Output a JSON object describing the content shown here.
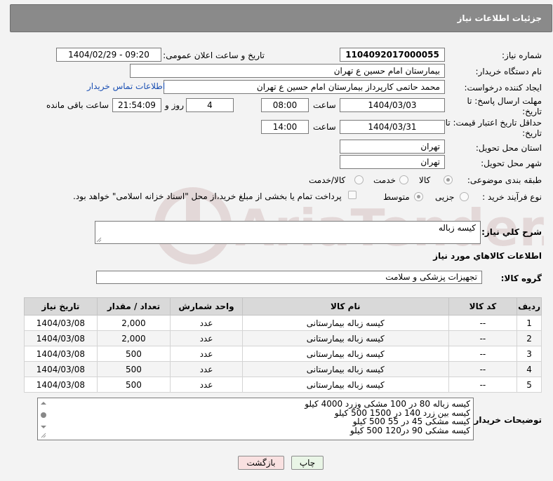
{
  "header": {
    "title": "جزئیات اطلاعات نیاز"
  },
  "fields": {
    "need_number_label": "شماره نیاز:",
    "need_number": "1104092017000055",
    "announce_label": "تاریخ و ساعت اعلان عمومی:",
    "announce_value": "1404/02/29 - 09:20",
    "buyer_org_label": "نام دستگاه خریدار:",
    "buyer_org": "بیمارستان امام حسین  ع  تهران",
    "requester_label": "ایجاد کننده درخواست:",
    "requester": "محمد حاتمی کارپرداز بیمارستان امام حسین  ع  تهران",
    "contact_link": "اطلاعات تماس خریدار",
    "deadline_label": "مهلت ارسال پاسخ: تا تاریخ:",
    "deadline_date": "1404/03/03",
    "time_label": "ساعت",
    "deadline_time": "08:00",
    "days_value": "4",
    "days_label": "روز و",
    "remaining_time": "21:54:09",
    "remaining_label": "ساعت باقی مانده",
    "validity_label": "حداقل تاریخ اعتبار قیمت: تا تاریخ:",
    "validity_date": "1404/03/31",
    "validity_time": "14:00",
    "province_label": "استان محل تحویل:",
    "province": "تهران",
    "city_label": "شهر محل تحویل:",
    "city": "تهران",
    "category_label": "طبقه بندی موضوعی:",
    "category_options": [
      "کالا",
      "خدمت",
      "کالا/خدمت"
    ],
    "process_label": "نوع فرآیند خرید :",
    "process_options": [
      "جزیی",
      "متوسط"
    ],
    "payment_note": "پرداخت تمام یا بخشی از مبلغ خرید،از محل \"اسناد خزانه اسلامی\" خواهد بود.",
    "summary_label": "شرح کلي نياز:",
    "summary": "کیسه زباله",
    "goods_info_label": "اطلاعات کالاهاي مورد نياز",
    "goods_group_label": "گروه کالا:",
    "goods_group": "تجهیزات پزشکی و سلامت",
    "notes_label": "توضیحات خریدار:"
  },
  "table": {
    "headers": [
      "ردیف",
      "کد کالا",
      "نام کالا",
      "واحد شمارش",
      "تعداد / مقدار",
      "تاریخ نیاز"
    ],
    "rows": [
      [
        "1",
        "--",
        "کیسه زباله بیمارستانی",
        "عدد",
        "2,000",
        "1404/03/08"
      ],
      [
        "2",
        "--",
        "کیسه زباله بیمارستانی",
        "عدد",
        "2,000",
        "1404/03/08"
      ],
      [
        "3",
        "--",
        "کیسه زباله بیمارستانی",
        "عدد",
        "500",
        "1404/03/08"
      ],
      [
        "4",
        "--",
        "کیسه زباله بیمارستانی",
        "عدد",
        "500",
        "1404/03/08"
      ],
      [
        "5",
        "--",
        "کیسه زباله بیمارستانی",
        "عدد",
        "500",
        "1404/03/08"
      ]
    ]
  },
  "notes": [
    "کیسه زباله 80 در 100 مشکی وزرد 4000 کیلو",
    "کیسه بین زرد 140 در 1500  500 کیلو",
    "کیسه مشکی 45 در 55  500 کیلو",
    "کیسه مشکی 90 در120   500 کیلو"
  ],
  "buttons": {
    "print": "چاپ",
    "back": "بازگشت"
  },
  "watermark": "AriaTender.net"
}
